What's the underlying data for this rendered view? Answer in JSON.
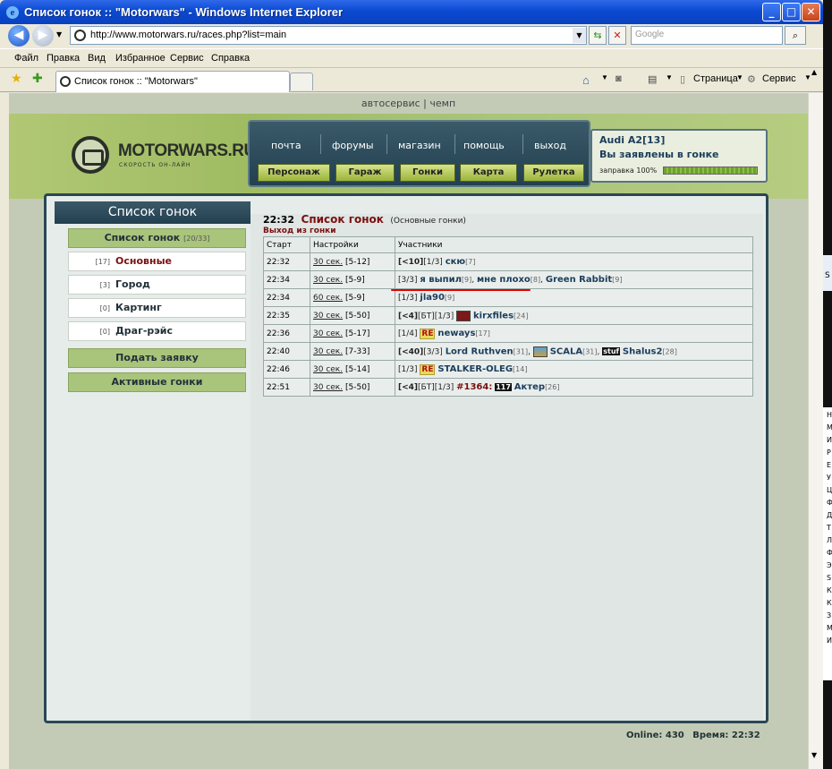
{
  "window": {
    "title": "Список гонок :: \"Motorwars\" - Windows Internet Explorer",
    "controls": {
      "minimize": "_",
      "maximize": "□",
      "close": "✕"
    }
  },
  "address": {
    "url": "http://www.motorwars.ru/races.php?list=main",
    "search_placeholder": "Google"
  },
  "menu": [
    "Файл",
    "Правка",
    "Вид",
    "Избранное",
    "Сервис",
    "Справка"
  ],
  "tab": {
    "title": "Список гонок :: \"Motorwars\""
  },
  "toolbar_right": {
    "page": "Страница",
    "tools": "Сервис"
  },
  "site": {
    "top_links": {
      "autoservice": "автосервис",
      "sep": "|",
      "champ": "чемп"
    },
    "logo": {
      "text": "MOTORWARS.RU",
      "slogan": "СКОРОСТЬ ОН-ЛАЙН"
    },
    "nav": [
      "почта",
      "форумы",
      "магазин",
      "помощь",
      "выход"
    ],
    "buttons": [
      "Персонаж",
      "Гараж",
      "Гонки",
      "Карта",
      "Рулетка"
    ],
    "status": {
      "car": "Audi A2[13]",
      "race_status": "Вы заявлены в гонке",
      "fuel_label": "заправка 100%",
      "fuel_level": 1.0
    }
  },
  "sidebar": {
    "title": "Список гонок",
    "list_header": {
      "label": "Список гонок",
      "count": "[20/33]"
    },
    "items": [
      {
        "count": "[17]",
        "label": "Основные",
        "active": true
      },
      {
        "count": "[3]",
        "label": "Город",
        "active": false
      },
      {
        "count": "[0]",
        "label": "Картинг",
        "active": false
      },
      {
        "count": "[0]",
        "label": "Драг-рэйс",
        "active": false
      }
    ],
    "apply": "Подать заявку",
    "active_races": "Активные гонки"
  },
  "races": {
    "time": "22:32",
    "title": "Список гонок",
    "subtitle": "(Основные гонки)",
    "exit": "Выход из гонки",
    "columns": [
      "Старт",
      "Настройки",
      "Участники"
    ],
    "rows": [
      {
        "start": "22:32",
        "time_setting": "30 сек.",
        "range": "[5-12]"
      },
      {
        "start": "22:34",
        "time_setting": "30 сек.",
        "range": "[5-9]"
      },
      {
        "start": "22:34",
        "time_setting": "60 сек.",
        "range": "[5-9]"
      },
      {
        "start": "22:35",
        "time_setting": "30 сек.",
        "range": "[5-50]"
      },
      {
        "start": "22:36",
        "time_setting": "30 сек.",
        "range": "[5-17]"
      },
      {
        "start": "22:40",
        "time_setting": "30 сек.",
        "range": "[7-33]"
      },
      {
        "start": "22:46",
        "time_setting": "30 сек.",
        "range": "[5-14]"
      },
      {
        "start": "22:51",
        "time_setting": "30 сек.",
        "range": "[5-50]"
      }
    ],
    "participants": {
      "r0": {
        "tag": "[<10]",
        "slots": "[1/3]",
        "p1": "скю",
        "l1": "[7]"
      },
      "r1": {
        "slots": "[3/3]",
        "p1": "я выпил",
        "l1": "[9]",
        "comma1": ",",
        "p2": "мне плохо",
        "l2": "[8]",
        "comma2": ",",
        "p3": "Green Rabbit",
        "l3": "[9]"
      },
      "r2": {
        "slots": "[1/3]",
        "p1": "jla90",
        "l1": "[9]"
      },
      "r3": {
        "tag": "[<4]",
        "bt": "[БТ]",
        "slots": "[1/3]",
        "p1": "kirxfiles",
        "l1": "[24]"
      },
      "r4": {
        "slots": "[1/4]",
        "badge": "RE",
        "p1": "neways",
        "l1": "[17]"
      },
      "r5": {
        "tag": "[<40]",
        "slots": "[3/3]",
        "p1": "Lord Ruthven",
        "l1": "[31]",
        "comma1": ",",
        "p2": "SCALA",
        "l2": "[31]",
        "comma2": ",",
        "badge": "stuf",
        "p3": "Shalus2",
        "l3": "[28]"
      },
      "r6": {
        "slots": "[1/3]",
        "badge": "RE",
        "p1": "STALKER-OLEG",
        "l1": "[14]"
      },
      "r7": {
        "tag": "[<4]",
        "bt": "[БТ]",
        "slots": "[1/3]",
        "team": "#1364:",
        "badge": "117",
        "p1": "Актер",
        "l1": "[26]"
      }
    }
  },
  "footer": {
    "online_label": "Online:",
    "online": "430",
    "time_label": "Время:",
    "time": "22:32"
  },
  "colors": {
    "titlebar": "#0a4ad2",
    "nav_panel": "#2a4755",
    "accent_green": "#a9c47b",
    "player_name": "#1b3d5c",
    "highlight": "#7a1010",
    "underline": "#e00000"
  }
}
